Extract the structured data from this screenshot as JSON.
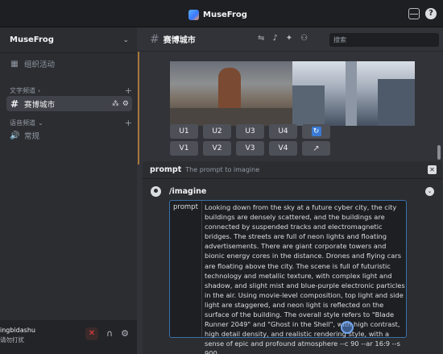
{
  "app": {
    "title": "MuseFrog"
  },
  "sidebar": {
    "server_name": "MuseFrog",
    "top_item": "组织活动",
    "text_category": "文字频道",
    "active_channel": "赛博城市",
    "voice_category": "语音频道",
    "voice_channel": "常规"
  },
  "user": {
    "name": "ingbidashu",
    "status": "请勿打扰"
  },
  "channel": {
    "title": "赛博城市",
    "search_placeholder": "搜索"
  },
  "buttons": {
    "upscale": [
      "U1",
      "U2",
      "U3",
      "U4"
    ],
    "variation": [
      "V1",
      "V2",
      "V3",
      "V4"
    ]
  },
  "prompt_panel": {
    "title": "prompt",
    "subtitle": "The prompt to imagine",
    "command": "/imagine",
    "param_label": "prompt",
    "param_value": "Looking down from the sky at a future cyber city, the city buildings are densely scattered, and the buildings are connected by suspended tracks and electromagnetic bridges. The streets are full of neon lights and floating advertisements. There are giant corporate towers and bionic energy cores in the distance. Drones and flying cars are floating above the city. The scene is full of futuristic technology and metallic texture, with complex light and shadow, and slight mist and blue-purple electronic particles in the air. Using movie-level composition, top light and side light are staggered, and neon light is reflected on the surface of the building. The overall style refers to \"Blade Runner 2049\" and \"Ghost in the Shell\", with high contrast, high detail density, and realistic rendering style, with a sense of epic and profound atmosphere --c 90 --ar 16:9 --s 900"
  },
  "icons": {
    "help": "?",
    "chevron": "⌄",
    "calendar": "▦",
    "hash": "#",
    "speaker": "🔊",
    "mute": "✕",
    "headphones": "∩",
    "gear": "⚙",
    "reroll": "↻",
    "link": "↗",
    "close": "✕",
    "check": "⌄"
  }
}
